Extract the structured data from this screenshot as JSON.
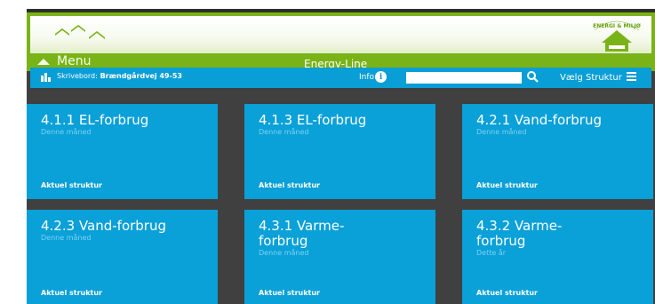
{
  "header": {
    "menu_label": "Menu",
    "app_title": "Energy-Line",
    "logo_text": "ENERGI & MILJØ"
  },
  "toolbar": {
    "path_prefix": "Skrivebord:",
    "path_value": "Brændgårdvej 49-53",
    "info_label": "Info",
    "info_icon": "i",
    "search_value": "",
    "structure_label": "Vælg Struktur"
  },
  "tiles": [
    {
      "title": "4.1.1 EL-forbrug",
      "subtitle": "Denne måned",
      "footer": "Aktuel struktur"
    },
    {
      "title": "4.1.3 EL-forbrug",
      "subtitle": "Denne måned",
      "footer": "Aktuel struktur"
    },
    {
      "title": "4.2.1 Vand-forbrug",
      "subtitle": "Denne måned",
      "footer": "Aktuel struktur"
    },
    {
      "title": "4.2.3 Vand-forbrug",
      "subtitle": "Denne måned",
      "footer": "Aktuel struktur"
    },
    {
      "title": "4.3.1 Varme-forbrug",
      "subtitle": "Denne måned",
      "footer": "Aktuel struktur"
    },
    {
      "title": "4.3.2 Varme-forbrug",
      "subtitle": "Dette år",
      "footer": "Aktuel struktur"
    }
  ],
  "colors": {
    "header_green": "#7ab317",
    "toolbar_blue": "#0a9ed6",
    "tile_blue": "#0aa0d8",
    "background": "#404040"
  }
}
